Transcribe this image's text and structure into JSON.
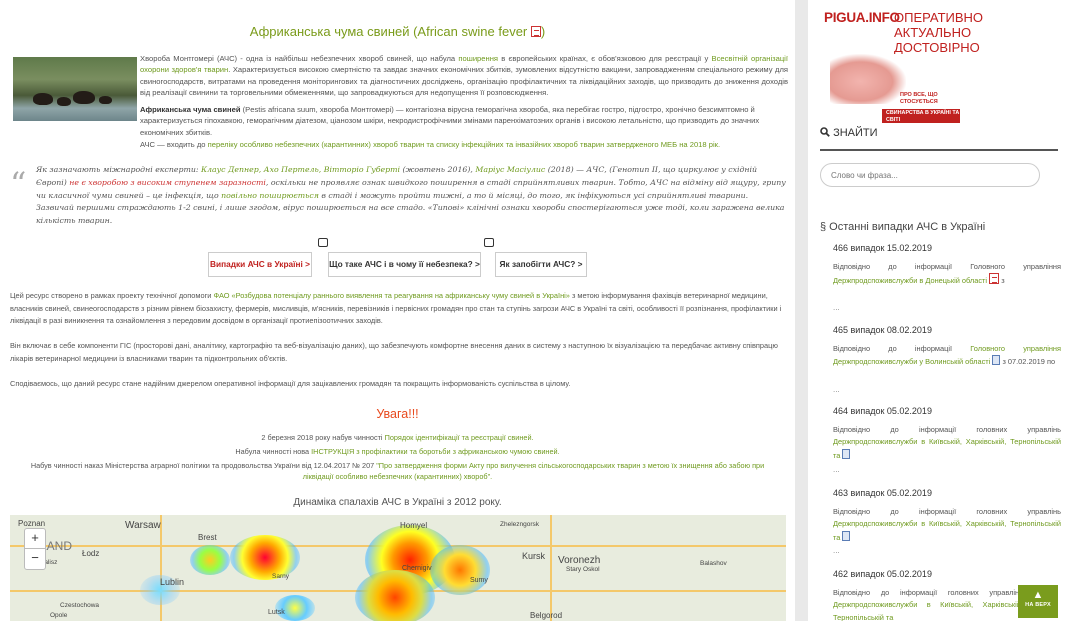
{
  "main": {
    "title": "Африканська чума свиней (African swine fever",
    "title_close": ")",
    "intro_p1": "Хвороба Монтгомері (АЧС) - одна із найбільш небезпечних хвороб свиней, що набула",
    "intro_link1": "поширення",
    "intro_p1b": "в європейських країнах, є обов'язковою для реєстрації у",
    "intro_link2": "Всесвітній організації охорони здоров'я тварин",
    "intro_p1c": ". Характеризується високою смертністю та завдає значних економічних збитків, зумовлених відсутністю вакцини, запровадженням спеціального режиму для свиногосподарств, витратами на проведення моніторингових та діагностичних досліджень, організацію профілактичних та ліквідаційних заходів, що призводить до зниження доходів від реалізації свинини та торговельними обмеженнями, що запроваджуються для недопущення її розповсюдження.",
    "intro_p2_bold": "Африканська чума свиней",
    "intro_p2": "(Pestis africana suum, хвороба Монтгомері) — контагіозна вірусна геморагічна хвороба, яка перебігає гостро, підгостро, хронічно безсимптомно й характеризується гіпохавкою, геморагічним діатезом, ціанозом шкіри, некродистрофічними змінами паренхіматозних органів і високою летальністю, що призводить до значних економічних збитків.",
    "intro_p3a": "АЧС — входить до",
    "intro_p3_link": "переліку особливо небезпечних (карантинних) хвороб тварин та списку інфекційних та інвазійних хвороб тварин затвердженого МЕБ на 2018 рік.",
    "quote_a": "Як зазначають міжнародні експерти:",
    "quote_link1": "Клаус Депнер, Ахо Пертель, Вітторіо Губерті",
    "quote_b": "(жовтень 2016),",
    "quote_link2": "Маріус Масіулис",
    "quote_c": "(2018) — АЧС, (Генотип II, що циркулює у східній Європі)",
    "quote_red": "не є хворобою з високим ступенем заразності",
    "quote_d": ", оскільки не проявляє ознак швидкого поширення в стаді сприйнятливих тварин. Тобто, АЧС на відміну від ящуру, грипу чи класичної чуми свиней – це інфекція, що",
    "quote_link3": "повільно поширюється",
    "quote_e": "в стаді і можуть пройти тижні, а то й місяці, до того, як інфікуються усі сприйнятливі тварини. Зазвичай першими страждають 1-2 свині, і лише згодом, вірус поширюється на все стадо. «Типові» клінічні ознаки хвороби спостерігаються уже тоді, коли заражена велика кількість тварин.",
    "buttons": [
      "Випадки АЧС в Україні >",
      "Що таке АЧС і в чому її небезпека? >",
      "Як запобігти АЧС? >"
    ],
    "para1a": "Цей ресурс створено в рамках проекту технічної допомоги",
    "para1_link": "ФАО «Розбудова потенціалу раннього виявлення та реагування на африканську чуму свиней в Україні»",
    "para1b": "з метою інформування фахівців ветеринарної медицини, власників свиней, свинеогосподарств з різним рівнем біозахисту, фермерів, мисливців, м'ясників, перевізників і первісних громадян про стан та ступінь загрози АЧС в Україні та світі, особливості її розпізнання, профілактики і ліквідації в разі виникнення та ознайомлення з передовим досвідом в організації протиепізоотичних заходів.",
    "para2": "Він включає в себе компоненти ГІС (просторові дані, аналітику, картографію та веб-візуалізацію даних), що забезпечують комфортне внесення даних в систему з наступною їх візуалізацією та передбачає активну співпрацю лікарів ветеринарної медицини із власниками тварин та підконтрольних об'єктів.",
    "para3": "Сподіваємось, що даний ресурс стане надійним джерелом оперативної інформації для зацікавлених громадян та покращить інформованість суспільства в цілому.",
    "warning": "Увага!!!",
    "notice1a": "2 березня 2018 року набув чинності",
    "notice1_link": "Порядок ідентифікації та реєстрації свиней.",
    "notice2a": "Набула чинності нова",
    "notice2_link": "ІНСТРУКЦІЯ з профілактики та боротьби з африканською чумою свиней.",
    "notice3a": "Набув чинності наказ Міністерства аграрної політики та продовольства України від 12.04.2017 № 207",
    "notice3_link": "\"Про затвердження форми Акту про вилучення сільськогосподарських тварин з метою їх знищення або забою при ліквідації особливо небезпечних (карантинних) хвороб\".",
    "chart_title": "Динаміка спалахів АЧС в Україні з 2012 року.",
    "map_labels": [
      "Poznan",
      "Warsaw",
      "LAND",
      "Łodz",
      "Kalisz",
      "Lublin",
      "Czestochowa",
      "Opole",
      "Brest",
      "Homyel",
      "Zhelezngorsk",
      "Kursk",
      "Voronezh",
      "Stary Oskol",
      "Belgorod",
      "Lutsk",
      "Sarny",
      "Chernigiv",
      "Sumy",
      "Balashov"
    ],
    "zoom_in": "+",
    "zoom_out": "−"
  },
  "sidebar": {
    "logo_brand": "PIGUA.INFO",
    "logo_tagline": [
      "ОПЕРАТИВНО",
      "АКТУАЛЬНО",
      "ДОСТОВІРНО"
    ],
    "logo_sub": "ПРО ВСЕ, ЩО СТОСУЄТЬСЯ",
    "logo_sub2": "СВИНАРСТВА В УКРАЇНІ ТА СВІТІ",
    "find_label": "ЗНАЙТИ",
    "search_placeholder": "Слово чи фраза...",
    "section_title": "§ Останні випадки АЧС в Україні",
    "cases": [
      {
        "title": "466 випадок 15.02.2019",
        "text_a": "Відповідно до інформації Головного управління",
        "link": "Держпродспоживслужби в Донецькій області",
        "text_b": "з"
      },
      {
        "title": "465 випадок 08.02.2019",
        "text_a": "Відповідно до інформації",
        "link_a": "Головного управління",
        "link": "Держпродспоживслужби у Волинській області",
        "text_b": "з 07.02.2019 по"
      },
      {
        "title": "464 випадок 05.02.2019",
        "text_a": "Відповідно до інформації головних управлінь",
        "link": "Держпродспоживслужби в Київській, Харківській, Тернопільській та",
        "text_b": ""
      },
      {
        "title": "463 випадок 05.02.2019",
        "text_a": "Відповідно до інформації головних управлінь",
        "link": "Держпродспоживслужби в Київській, Харківській, Тернопільській та",
        "text_b": ""
      },
      {
        "title": "462 випадок 05.02.2019",
        "text_a": "Відповідно до інформації головних управлінь",
        "link": "Держпродспоживслужби в Київській, Харківській, Тернопільській та",
        "text_b": ""
      }
    ],
    "dots": "...",
    "up_label": "НА ВЕРХ"
  },
  "colors": {
    "accent": "#7a9c1d",
    "link": "#6f9a1e",
    "warning": "#e8491d",
    "brand": "#c0211f"
  }
}
